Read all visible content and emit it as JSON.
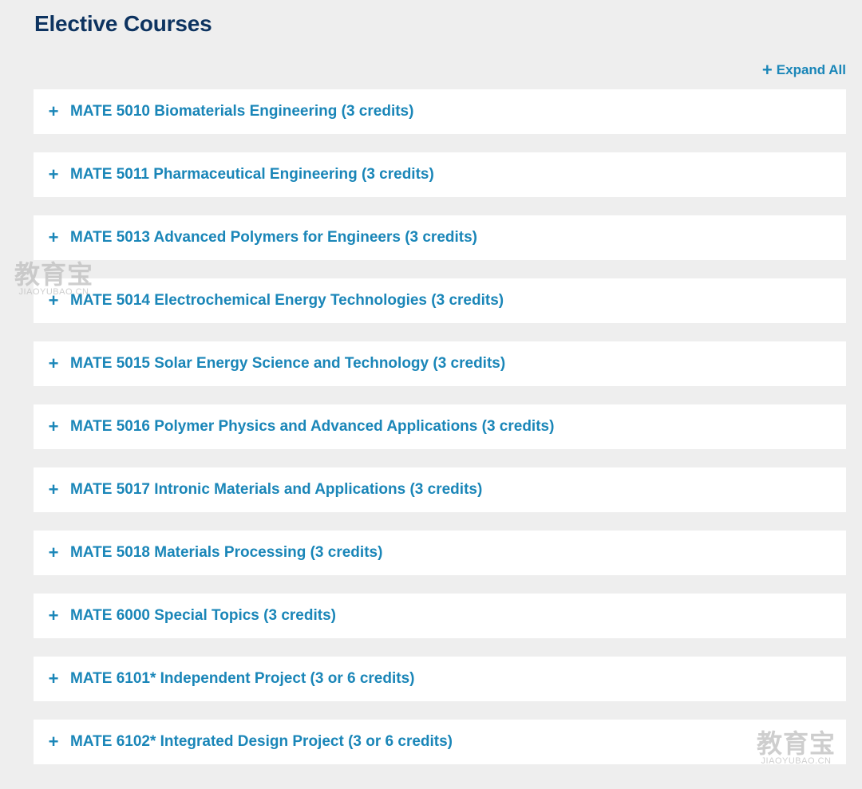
{
  "page": {
    "title": "Elective Courses",
    "expand_all_label": "Expand All",
    "expand_icon": "plus-icon"
  },
  "courses": [
    {
      "label": "MATE 5010 Biomaterials Engineering (3 credits)"
    },
    {
      "label": "MATE 5011 Pharmaceutical Engineering (3 credits)"
    },
    {
      "label": "MATE 5013 Advanced Polymers for Engineers (3 credits)"
    },
    {
      "label": "MATE 5014 Electrochemical Energy Technologies (3 credits)"
    },
    {
      "label": "MATE 5015 Solar Energy Science and Technology (3 credits)"
    },
    {
      "label": "MATE 5016 Polymer Physics and Advanced Applications (3 credits)"
    },
    {
      "label": "MATE 5017 Intronic Materials and Applications (3 credits)"
    },
    {
      "label": "MATE 5018 Materials Processing (3 credits)"
    },
    {
      "label": "MATE 6000 Special Topics (3 credits)"
    },
    {
      "label": "MATE 6101* Independent Project (3 or 6 credits)"
    },
    {
      "label": "MATE 6102* Integrated Design Project (3 or 6 credits)"
    }
  ],
  "watermark": {
    "main": "教育宝",
    "sub_left": "JIAOYUBAO.CN",
    "sub_right": "JIAOYUBAO.CN"
  },
  "colors": {
    "title": "#0d3360",
    "accent": "#1a86b8",
    "background": "#eeeeee",
    "card": "#ffffff"
  }
}
